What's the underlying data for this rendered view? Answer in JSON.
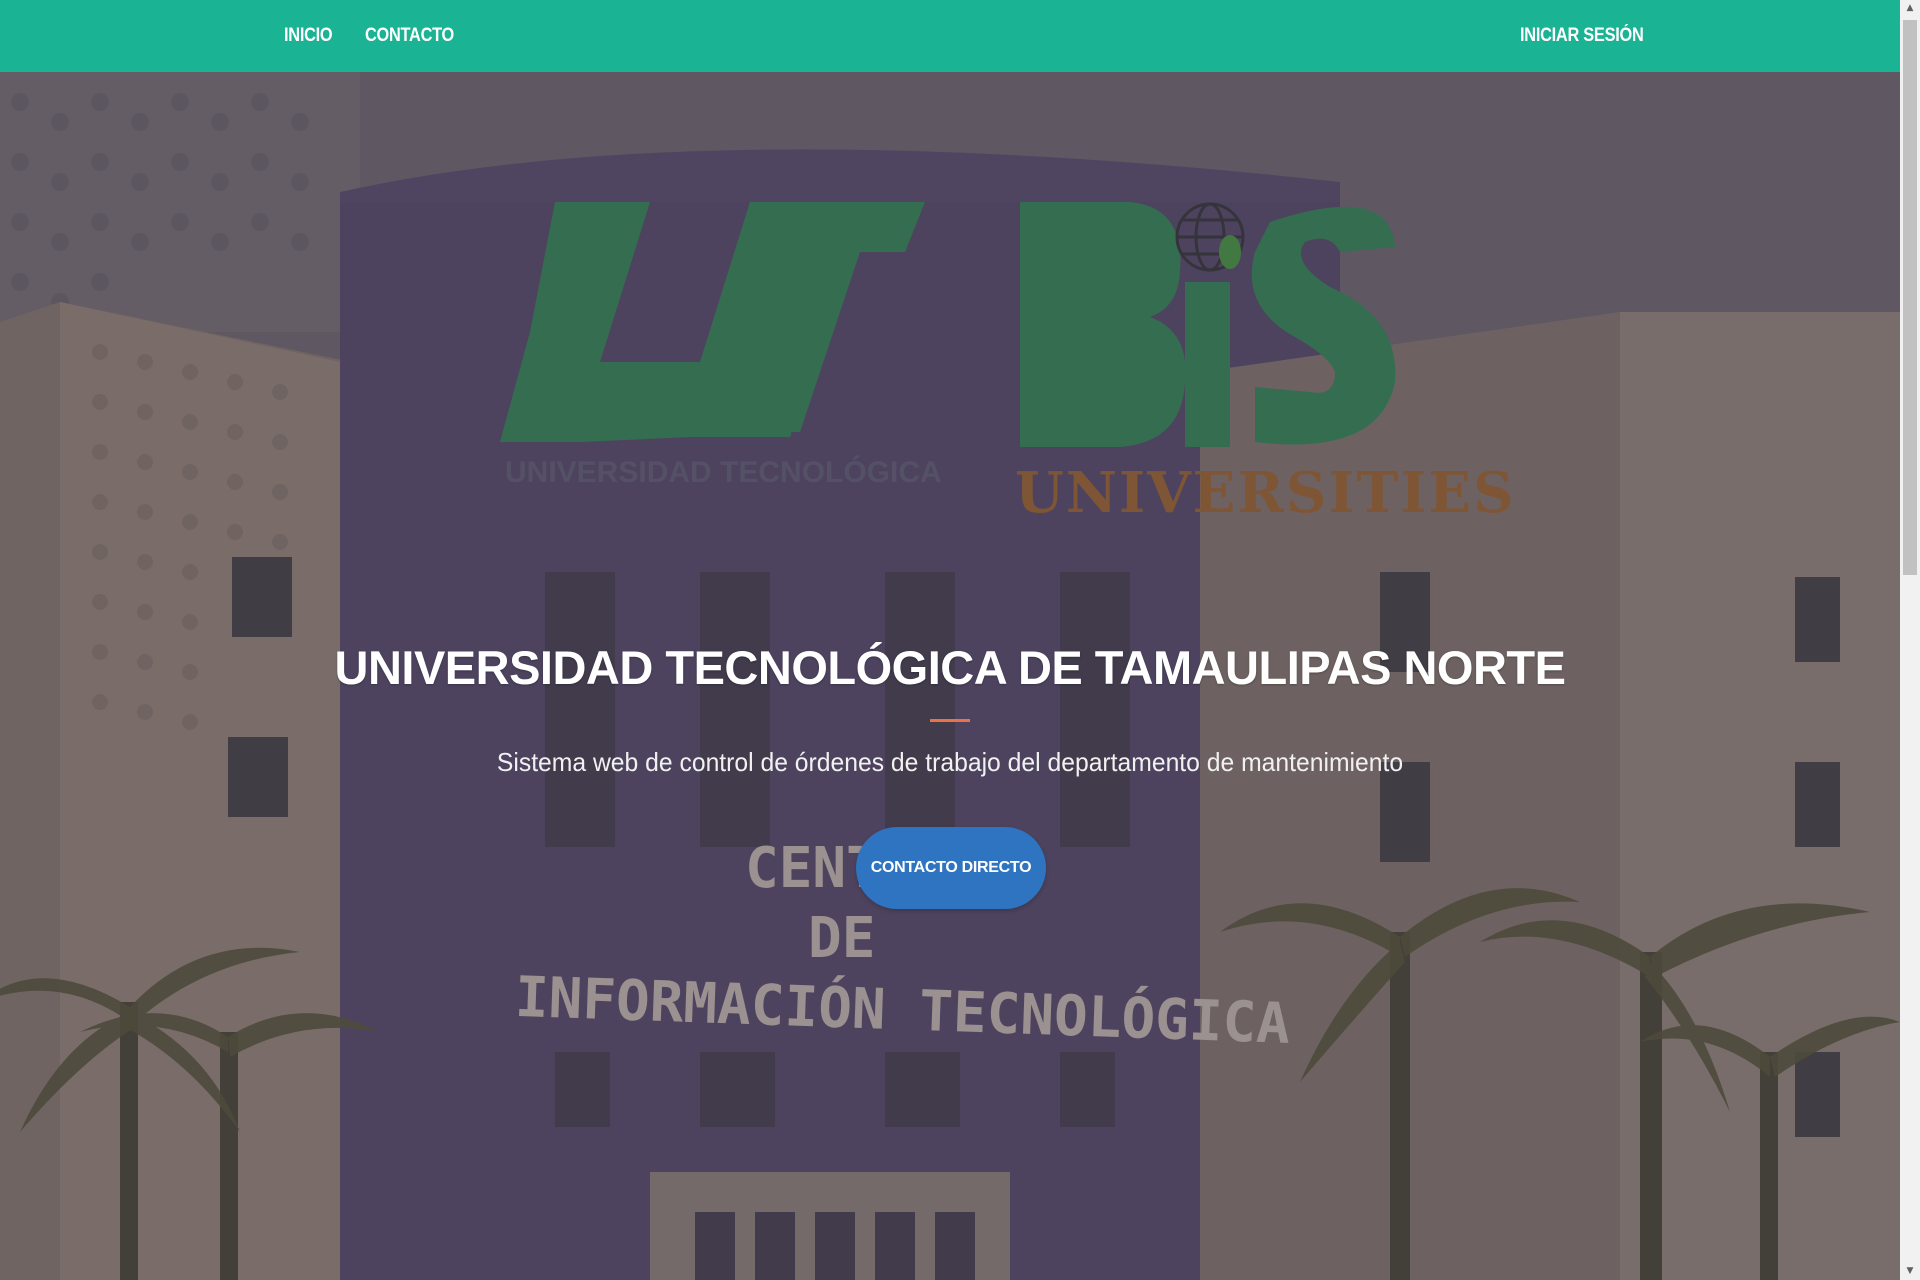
{
  "navbar": {
    "links": [
      {
        "label": "INICIO"
      },
      {
        "label": "CONTACTO"
      }
    ],
    "login_label": "INICIAR SESIÓN",
    "background_color": "#1ab394"
  },
  "hero": {
    "title": "UNIVERSIDAD TECNOLÓGICA DE TAMAULIPAS NORTE",
    "subtitle": "Sistema web de control de órdenes de trabajo del departamento de mantenimiento",
    "cta_label": "CONTACTO DIRECTO",
    "divider_color": "#e8734a",
    "cta_color": "#2e74c0"
  },
  "background_image": {
    "logo_left_text": "UT",
    "logo_left_caption": "UNIVERSIDAD TECNOLÓGICA",
    "logo_right_text": "BiS",
    "logo_right_caption": "UNIVERSITIES",
    "building_sign_lines": [
      "CENTRO",
      "DE",
      "INFORMACIÓN TECNOLÓGICA"
    ]
  },
  "scrollbar": {
    "up_icon": "arrow-up-icon",
    "down_icon": "arrow-down-icon"
  }
}
